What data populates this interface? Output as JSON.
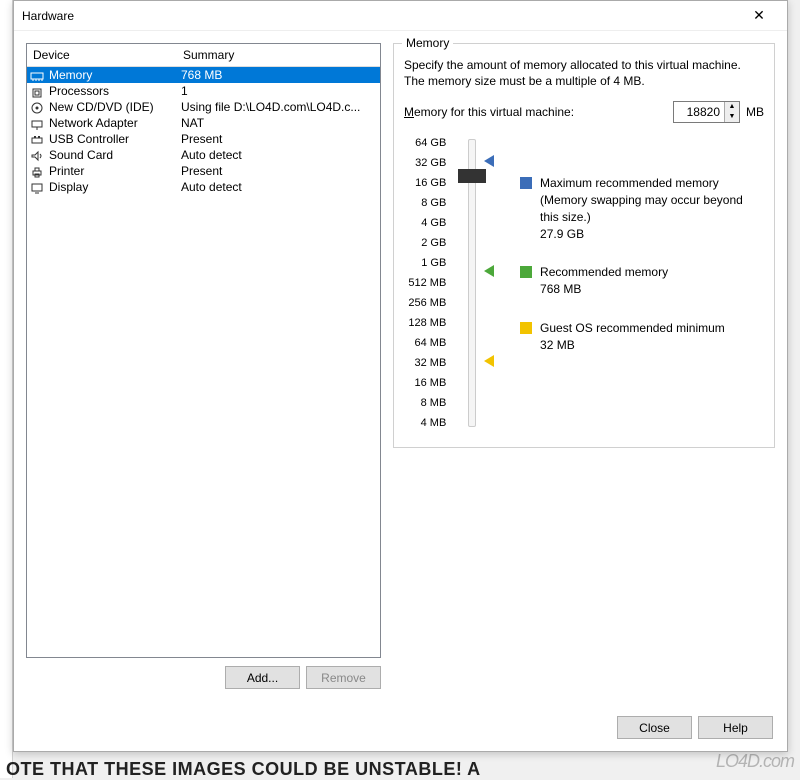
{
  "window": {
    "title": "Hardware"
  },
  "columns": {
    "device": "Device",
    "summary": "Summary"
  },
  "devices": [
    {
      "icon": "memory",
      "name": "Memory",
      "summary": "768 MB",
      "selected": true
    },
    {
      "icon": "cpu",
      "name": "Processors",
      "summary": "1"
    },
    {
      "icon": "disc",
      "name": "New CD/DVD (IDE)",
      "summary": "Using file D:\\LO4D.com\\LO4D.c..."
    },
    {
      "icon": "network",
      "name": "Network Adapter",
      "summary": "NAT"
    },
    {
      "icon": "usb",
      "name": "USB Controller",
      "summary": "Present"
    },
    {
      "icon": "sound",
      "name": "Sound Card",
      "summary": "Auto detect"
    },
    {
      "icon": "printer",
      "name": "Printer",
      "summary": "Present"
    },
    {
      "icon": "display",
      "name": "Display",
      "summary": "Auto detect"
    }
  ],
  "left_buttons": {
    "add": "Add...",
    "remove": "Remove"
  },
  "memory_panel": {
    "title": "Memory",
    "description": "Specify the amount of memory allocated to this virtual machine. The memory size must be a multiple of 4 MB.",
    "input_label_prefix": "M",
    "input_label_rest": "emory for this virtual machine:",
    "value": "18820",
    "unit": "MB",
    "ticks": [
      "64 GB",
      "32 GB",
      "16 GB",
      "8 GB",
      "4 GB",
      "2 GB",
      "1 GB",
      "512 MB",
      "256 MB",
      "128 MB",
      "64 MB",
      "32 MB",
      "16 MB",
      "8 MB",
      "4 MB"
    ],
    "legend": {
      "max": {
        "label": "Maximum recommended memory",
        "note": "(Memory swapping may occur beyond this size.)",
        "value": "27.9 GB",
        "color": "#3b6db8"
      },
      "rec": {
        "label": "Recommended memory",
        "value": "768 MB",
        "color": "#4ca83a"
      },
      "min": {
        "label": "Guest OS recommended minimum",
        "value": "32 MB",
        "color": "#f2c300"
      }
    }
  },
  "dialog_buttons": {
    "close": "Close",
    "help": "Help"
  },
  "watermark": "LO4D.com",
  "bg_text": "OTE THAT THESE IMAGES COULD BE UNSTABLE! A"
}
